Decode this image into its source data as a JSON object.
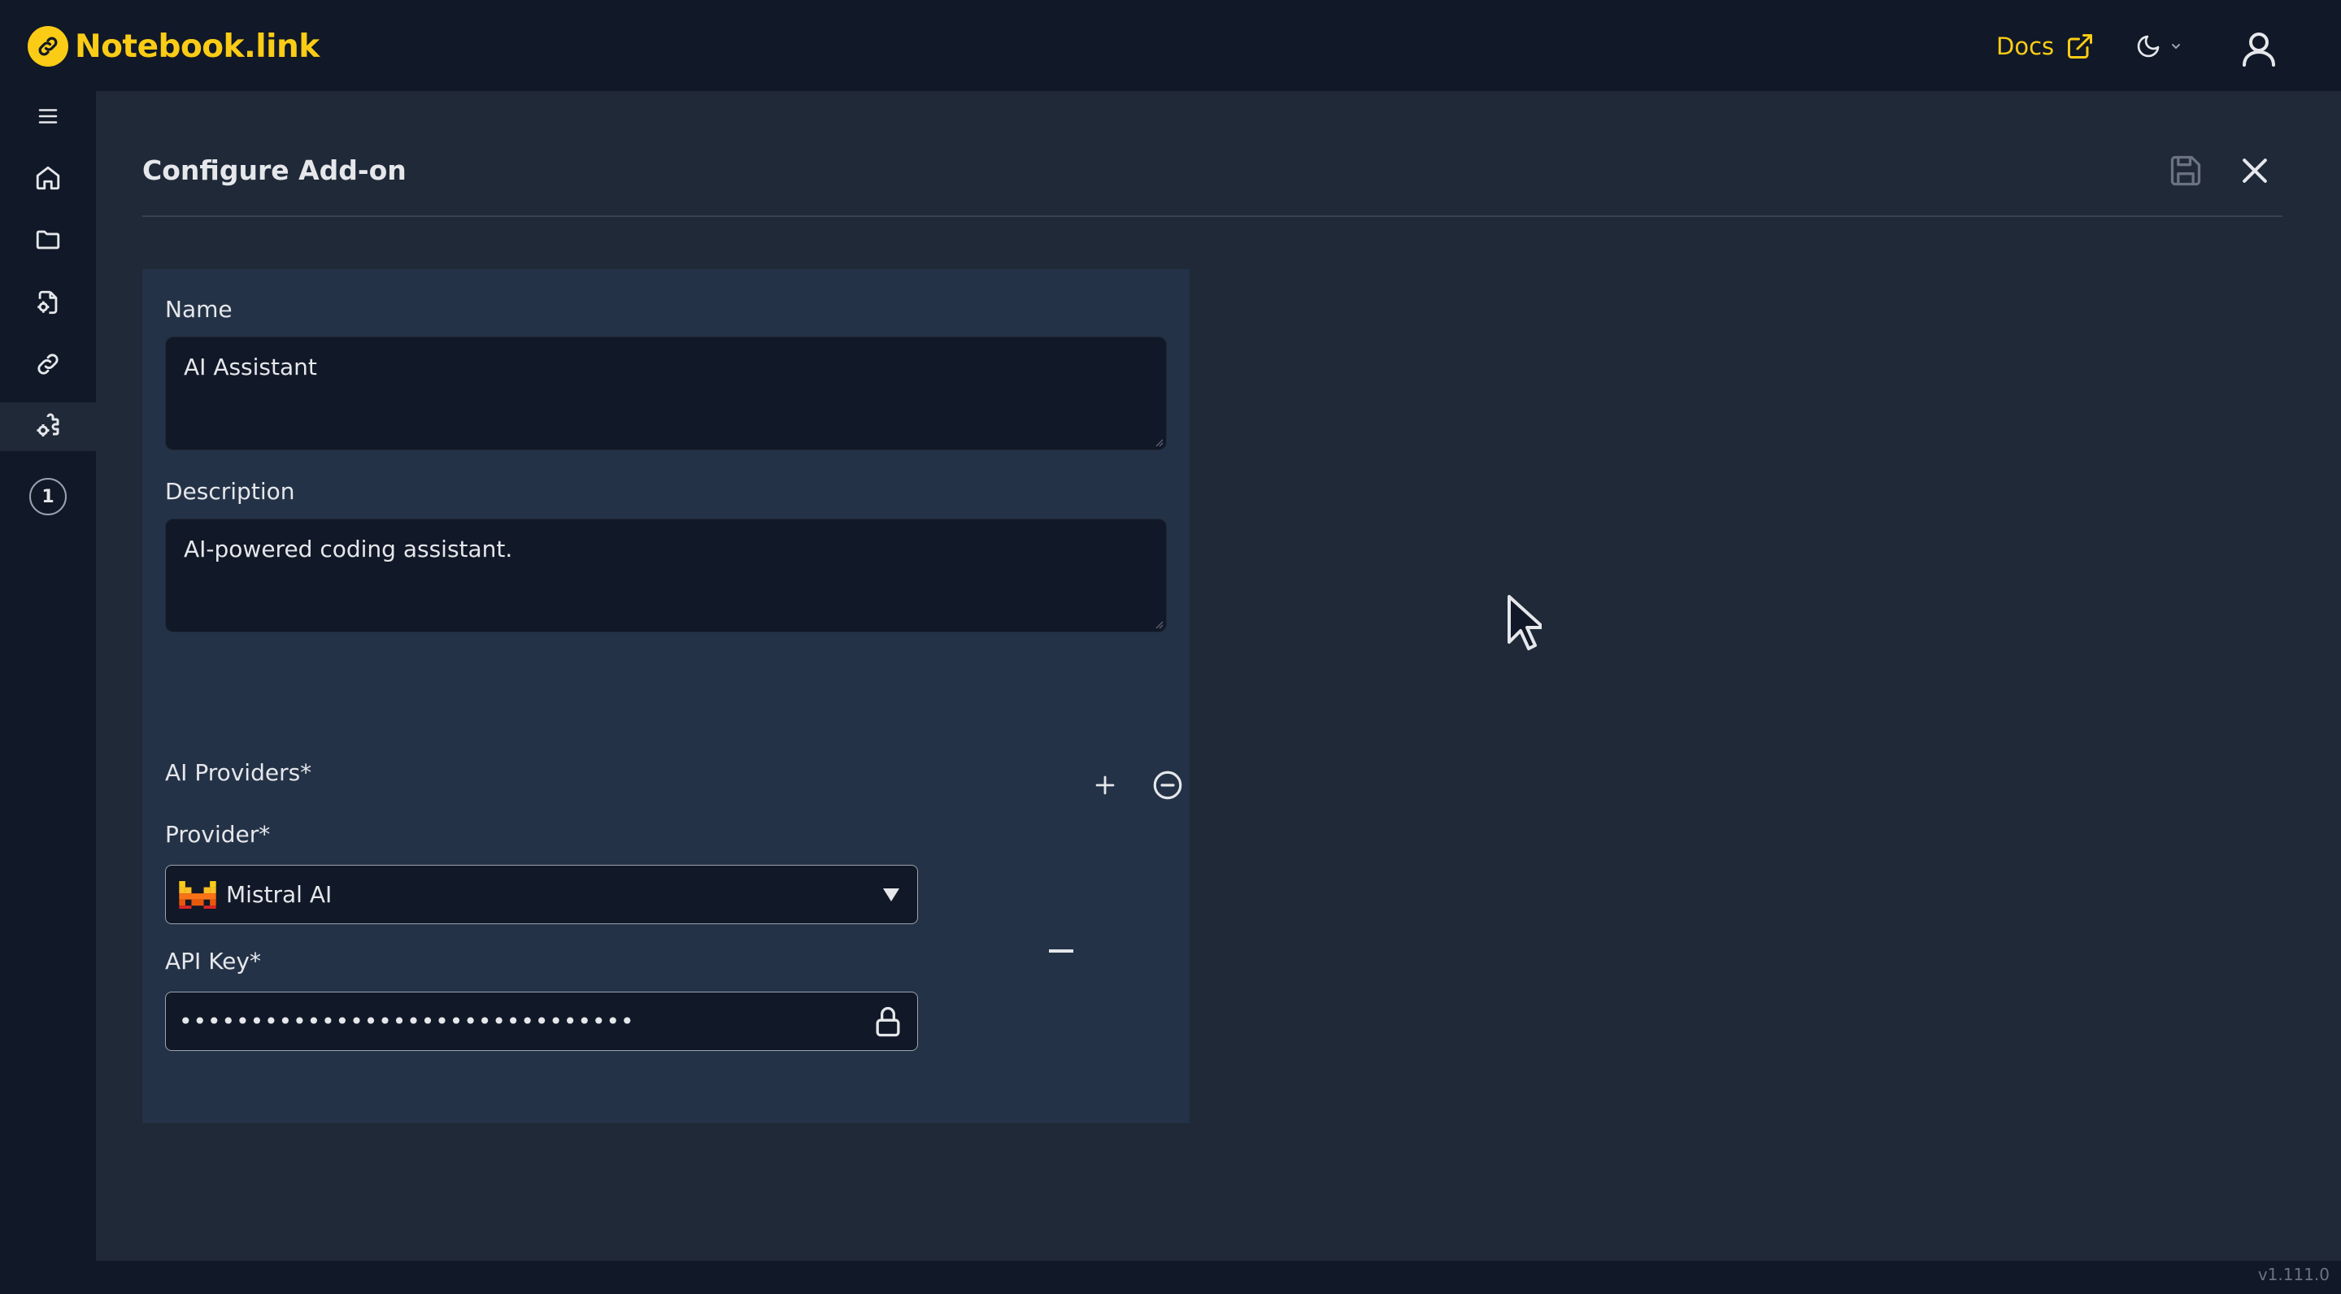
{
  "app": {
    "name": "Notebook.link",
    "version": "v1.111.0"
  },
  "topbar": {
    "docs_label": "Docs"
  },
  "sidebar": {
    "items": [
      {
        "name": "menu",
        "icon": "hamburger-icon"
      },
      {
        "name": "home",
        "icon": "home-icon"
      },
      {
        "name": "files",
        "icon": "folder-icon"
      },
      {
        "name": "notebooks",
        "icon": "file-settings-icon"
      },
      {
        "name": "links",
        "icon": "link-icon"
      },
      {
        "name": "add-ons",
        "icon": "puzzle-icon",
        "active": true
      },
      {
        "name": "notifications",
        "icon": "badge",
        "badge": "1"
      }
    ]
  },
  "page": {
    "title": "Configure Add-on"
  },
  "form": {
    "name_label": "Name",
    "name_value": "AI Assistant",
    "description_label": "Description",
    "description_value": "AI-powered coding assistant.",
    "providers_label": "AI Providers*",
    "provider_label": "Provider*",
    "provider_value": "Mistral AI",
    "api_key_label": "API Key*",
    "api_key_masked": "••••••••••••••••••••••••••••••••"
  },
  "colors": {
    "accent": "#facc15",
    "background": "#111827",
    "main": "#1f2937",
    "panel": "#243247"
  }
}
